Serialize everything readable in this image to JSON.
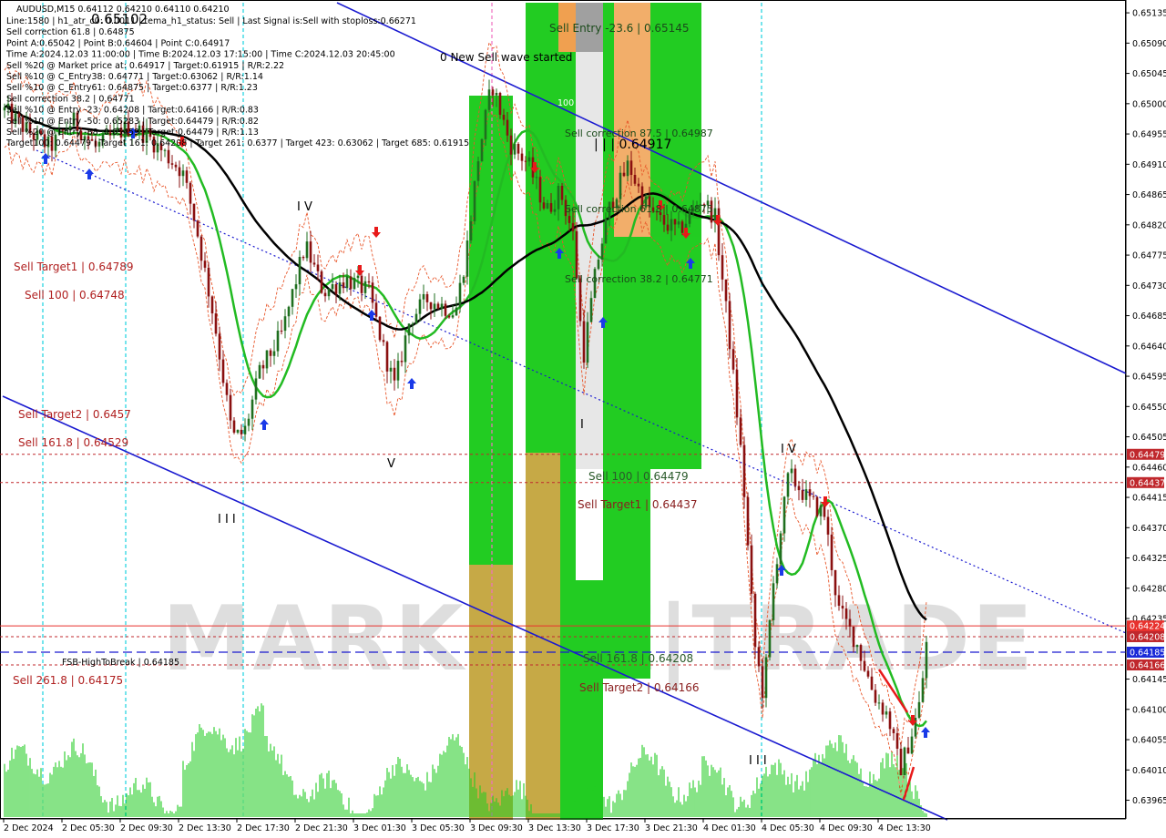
{
  "header": {
    "title": "AUDUSD,M15  0.64112 0.64210 0.64110 0.64210",
    "big_price": "0.65102",
    "lines": [
      "Line:1580 | h1_atr_c0: 0.0011 | tema_h1_status: Sell | Last Signal is:Sell with stoploss:0.66271",
      "Sell correction 61.8 | 0.64875",
      "Point A:0.65042 | Point B:0.64604 | Point C:0.64917",
      "Time A:2024.12.03 11:00:00 | Time B:2024.12.03 17:15:00 | Time C:2024.12.03 20:45:00",
      "Sell %20 @ Market price at: 0.64917 | Target:0.61915 | R/R:2.22",
      "Sell %10 @ C_Entry38: 0.64771 | Target:0.63062 | R/R:1.14",
      "Sell %10 @ C_Entry61: 0.64875 | Target:0.6377 | R/R:1.23",
      "Sell correction 38.2 | 0.64771",
      "Sell %10 @ Entry -23: 0.64208 | Target:0.64166 | R/R:0.83",
      "Sell %10 @ Entry -50: 0.65283 | Target:0.64479 | R/R:0.82",
      "Sell %20 @ Entry -88: 0.65459 | Target:0.64479 | R/R:1.13",
      "Target100: 0.64479 | Target 161: 0.64208 | Target 261: 0.6377 | Target 423: 0.63062 | Target 685: 0.61915"
    ]
  },
  "annotations": {
    "new_wave": "0 New Sell wave started",
    "sell_entry": "Sell Entry -23.6 | 0.65145",
    "correction_875": "Sell correction 87.5 | 0.64987",
    "point_c": "| | | 0.64917",
    "correction_618": "Sell correction 61.8 | 0.64875",
    "correction_382": "Sell correction 38.2 | 0.64771",
    "sell100_mid": "Sell 100 | 0.64479",
    "target1_mid": "Sell Target1 | 0.64437",
    "sell1618_mid": "Sell 161.8 | 0.64208",
    "target2_mid": "Sell Target2 | 0.64166",
    "target1_left": "Sell Target1 | 0.64789",
    "sell100_left": "Sell 100 | 0.64748",
    "target2_left": "Sell Target2 | 0.6457",
    "sell1618_left": "Sell 161.8 | 0.64529",
    "sell2618_left": "Sell 261.8 | 0.64175",
    "fsb_label": "FSB-HighToBreak | 0.64185",
    "wave_iv_left": "I V",
    "wave_v": "V",
    "wave_iii_left": "I I I",
    "wave_i": "I",
    "wave_iv_right": "I V",
    "wave_iii_right": "I I I",
    "label_100": "100"
  },
  "watermark": "MARKETZ|TRADE",
  "price_tags": [
    {
      "value": 0.64479,
      "label": "0.64479",
      "color": "#c0282d"
    },
    {
      "value": 0.64437,
      "label": "0.64437",
      "color": "#c0282d"
    },
    {
      "value": 0.64224,
      "label": "0.64224",
      "color": "#e8322e"
    },
    {
      "value": 0.64208,
      "label": "0.64208",
      "color": "#c0282d"
    },
    {
      "value": 0.64185,
      "label": "0.64185",
      "color": "#1a2ad8"
    },
    {
      "value": 0.64166,
      "label": "0.64166",
      "color": "#c0282d"
    }
  ],
  "colors": {
    "bull_candle": "#1f6f1f",
    "bear_candle": "#8a1010",
    "green_zone": "#22cc22",
    "orange_zone": "#f0a050",
    "gray_zone": "#a0a0a0",
    "channel": "#1a1ad0",
    "ma_fast": "#22bb22",
    "ma_slow": "#000000",
    "level": "#c0282d",
    "cyan_vline": "#19d3e0",
    "pink_vline": "#f070c0",
    "volume": "#22cc22"
  },
  "chart_data": {
    "type": "candlestick",
    "symbol": "AUDUSD",
    "timeframe": "M15",
    "ohlc_last": {
      "open": 0.64112,
      "high": 0.6421,
      "low": 0.6411,
      "close": 0.6421
    },
    "ylim": [
      0.6394,
      0.6515
    ],
    "y_ticks": [
      "0.65135",
      "0.65090",
      "0.65045",
      "0.65000",
      "0.64955",
      "0.64910",
      "0.64865",
      "0.64820",
      "0.64775",
      "0.64730",
      "0.64685",
      "0.64640",
      "0.64595",
      "0.64550",
      "0.64505",
      "0.64460",
      "0.64415",
      "0.64370",
      "0.64325",
      "0.64280",
      "0.64235",
      "0.64145",
      "0.64100",
      "0.64055",
      "0.64010",
      "0.63965"
    ],
    "x_ticks": [
      "2 Dec 2024",
      "2 Dec 05:30",
      "2 Dec 09:30",
      "2 Dec 13:30",
      "2 Dec 17:30",
      "2 Dec 21:30",
      "3 Dec 01:30",
      "3 Dec 05:30",
      "3 Dec 09:30",
      "3 Dec 13:30",
      "3 Dec 17:30",
      "3 Dec 21:30",
      "4 Dec 01:30",
      "4 Dec 05:30",
      "4 Dec 09:30",
      "4 Dec 13:30"
    ],
    "horizontal_levels": [
      {
        "name": "Sell 100",
        "value": 0.64479
      },
      {
        "name": "Sell Target1",
        "value": 0.64437
      },
      {
        "name": "Sell 161.8",
        "value": 0.64208
      },
      {
        "name": "FSB-HighToBreak",
        "value": 0.64185
      },
      {
        "name": "Sell Target2",
        "value": 0.64166
      },
      {
        "value": 0.64224
      }
    ],
    "points": {
      "A": 0.65042,
      "B": 0.64604,
      "C": 0.64917
    }
  }
}
